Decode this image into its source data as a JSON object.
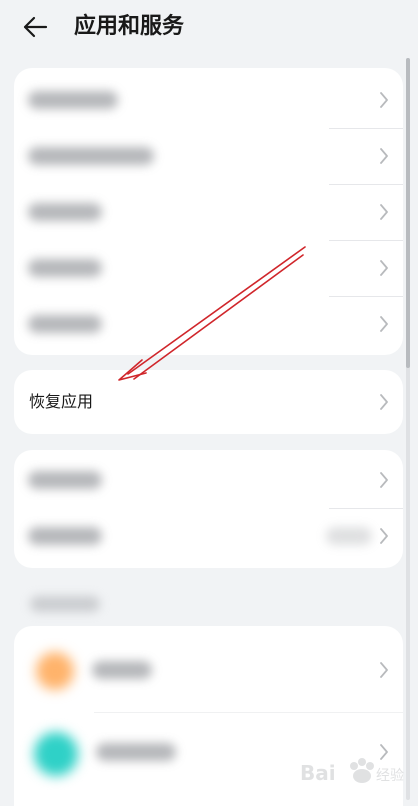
{
  "header": {
    "back_icon": "back-arrow-icon",
    "title": "应用和服务"
  },
  "card1": {
    "rows": [
      {
        "label": "",
        "icon": "chevron-right-icon"
      },
      {
        "label": "",
        "icon": "chevron-right-icon"
      },
      {
        "label": "",
        "icon": "chevron-right-icon"
      },
      {
        "label": "",
        "icon": "chevron-right-icon"
      },
      {
        "label": "",
        "icon": "chevron-right-icon"
      }
    ]
  },
  "restore": {
    "label": "恢复应用",
    "icon": "chevron-right-icon"
  },
  "card3": {
    "rows": [
      {
        "label": "",
        "icon": "chevron-right-icon"
      },
      {
        "label": "",
        "icon": "chevron-right-icon"
      }
    ]
  },
  "apps_card": {
    "items": [
      {
        "name": "",
        "icon_color": "#ffb36b"
      },
      {
        "name": "",
        "icon_color": "#2fd1c7"
      }
    ]
  },
  "annotation": {
    "color": "#d0262b"
  },
  "colors": {
    "background": "#f1f3f5",
    "card": "#ffffff",
    "text": "#191919",
    "chevron": "#b8babd"
  }
}
